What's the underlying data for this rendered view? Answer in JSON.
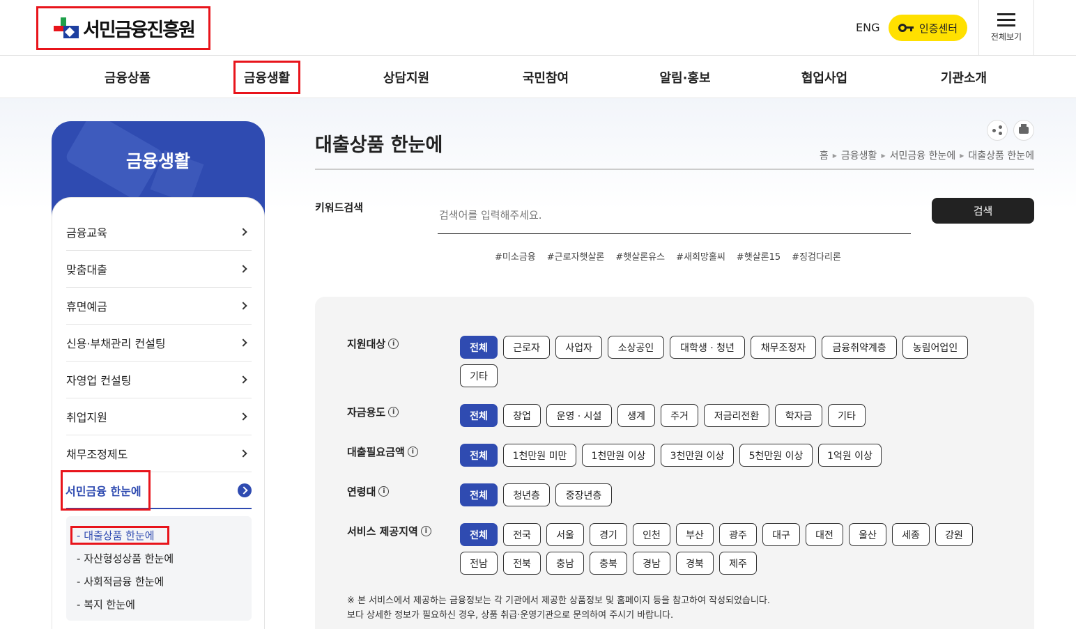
{
  "header": {
    "logo_text": "서민금융진흥원",
    "eng_label": "ENG",
    "cert_label": "인증센터",
    "allmenu_label": "전체보기"
  },
  "gnb": [
    "금융상품",
    "금융생활",
    "상담지원",
    "국민참여",
    "알림·홍보",
    "협업사업",
    "기관소개"
  ],
  "sidebar": {
    "title": "금융생활",
    "items": [
      "금융교육",
      "맞춤대출",
      "휴면예금",
      "신용·부채관리 컨설팅",
      "자영업 컨설팅",
      "취업지원",
      "채무조정제도",
      "서민금융 한눈에"
    ],
    "subitems": [
      "대출상품 한눈에",
      "자산형성상품 한눈에",
      "사회적금융 한눈에",
      "복지 한눈에"
    ]
  },
  "page": {
    "title": "대출상품 한눈에",
    "breadcrumb": [
      "홈",
      "금융생활",
      "서민금융 한눈에",
      "대출상품 한눈에"
    ]
  },
  "search": {
    "label": "키워드검색",
    "placeholder": "검색어를 입력해주세요.",
    "button": "검색",
    "tags": [
      "#미소금융",
      "#근로자햇살론",
      "#햇살론유스",
      "#새희망홀씨",
      "#햇살론15",
      "#징검다리론"
    ]
  },
  "filters": {
    "target": {
      "label": "지원대상",
      "options": [
        "전체",
        "근로자",
        "사업자",
        "소상공인",
        "대학생 · 청년",
        "채무조정자",
        "금융취약계층",
        "농림어업인",
        "기타"
      ]
    },
    "purpose": {
      "label": "자금용도",
      "options": [
        "전체",
        "창업",
        "운영 · 시설",
        "생계",
        "주거",
        "저금리전환",
        "학자금",
        "기타"
      ]
    },
    "amount": {
      "label": "대출필요금액",
      "options": [
        "전체",
        "1천만원 미만",
        "1천만원 이상",
        "3천만원 이상",
        "5천만원 이상",
        "1억원 이상"
      ]
    },
    "age": {
      "label": "연령대",
      "options": [
        "전체",
        "청년층",
        "중장년층"
      ]
    },
    "region": {
      "label": "서비스 제공지역",
      "options": [
        "전체",
        "전국",
        "서울",
        "경기",
        "인천",
        "부산",
        "광주",
        "대구",
        "대전",
        "울산",
        "세종",
        "강원",
        "전남",
        "전북",
        "충남",
        "충북",
        "경남",
        "경북",
        "제주"
      ]
    },
    "info_glyph": "i"
  },
  "notes": [
    "※ 본 서비스에서 제공하는 금융정보는 각 기관에서 제공한 상품정보 및 홈페이지 등을 참고하여 작성되었습니다.",
    "보다 상세한 정보가 필요하신 경우, 상품 취급·운영기관으로 문의하여 주시기 바랍니다."
  ],
  "colors": {
    "primary": "#2f4bb1",
    "highlight": "#e8141b",
    "cert": "#ffe000"
  }
}
